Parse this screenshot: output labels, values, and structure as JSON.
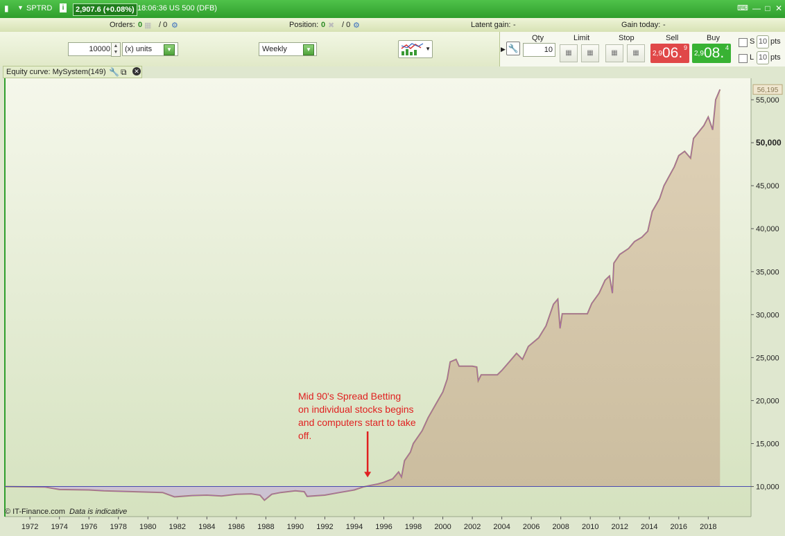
{
  "titlebar": {
    "symbol": "SPTRD",
    "price_change": "2,907.6 (+0.08%)",
    "time_market": "18:06:36 US 500 (DFB)"
  },
  "infobar": {
    "orders_label": "Orders:",
    "orders_value": "0",
    "orders_slash": "/ 0",
    "position_label": "Position:",
    "position_value": "0",
    "position_slash": "/ 0",
    "latent_label": "Latent gain:",
    "latent_value": "-",
    "gain_today_label": "Gain today:",
    "gain_today_value": "-"
  },
  "toolbar": {
    "quantity": "10000",
    "units": "(x) units",
    "timeframe": "Weekly"
  },
  "order_panel": {
    "qty_label": "Qty",
    "qty_value": "10",
    "limit_label": "Limit",
    "stop_label": "Stop",
    "sell_label": "Sell",
    "buy_label": "Buy",
    "sell_small": "2,9",
    "sell_big": "06.",
    "sell_sup": "9",
    "buy_small": "2,9",
    "buy_big": "08.",
    "buy_sup": "4",
    "s_label": "S",
    "l_label": "L",
    "s_pts_value": "10",
    "l_pts_value": "10",
    "pts_label": "pts"
  },
  "chart_panel": {
    "title": "Equity curve: MySystem(149)"
  },
  "footer": {
    "copyright": "© IT-Finance.com",
    "note": "Data is indicative"
  },
  "colors": {
    "title_green": "#38a834",
    "fill": "#d8cbb2",
    "line_main": "#a88a57",
    "line_spike": "#a25fd0",
    "baseline": "#4a4ab0",
    "below_fill": "#c8b3d8",
    "plot_bg_top": "#f4f6ea",
    "plot_bg_bottom": "#d7e4c1",
    "annotation": "#e02020"
  },
  "chart_data": {
    "type": "area",
    "title": "Equity curve: MySystem(149)",
    "xlabel": "",
    "ylabel": "",
    "xlim": [
      1970.3,
      2020.9
    ],
    "ylim": [
      6500,
      57500
    ],
    "baseline": 10000,
    "last_value_label": "56,195",
    "x_ticks": [
      1972,
      1974,
      1976,
      1978,
      1980,
      1982,
      1984,
      1986,
      1988,
      1990,
      1992,
      1994,
      1996,
      1998,
      2000,
      2002,
      2004,
      2006,
      2008,
      2010,
      2012,
      2014,
      2016,
      2018
    ],
    "y_ticks": [
      {
        "value": 10000,
        "label": "10,000",
        "bold": false
      },
      {
        "value": 15000,
        "label": "15,000",
        "bold": false
      },
      {
        "value": 20000,
        "label": "20,000",
        "bold": false
      },
      {
        "value": 25000,
        "label": "25,000",
        "bold": false
      },
      {
        "value": 30000,
        "label": "30,000",
        "bold": false
      },
      {
        "value": 35000,
        "label": "35,000",
        "bold": false
      },
      {
        "value": 40000,
        "label": "40,000",
        "bold": false
      },
      {
        "value": 45000,
        "label": "45,000",
        "bold": false
      },
      {
        "value": 50000,
        "label": "50,000",
        "bold": true
      },
      {
        "value": 55000,
        "label": "55,000",
        "bold": false
      }
    ],
    "series": [
      {
        "values": [
          [
            1970.3,
            10000
          ],
          [
            1973,
            9950
          ],
          [
            1974,
            9650
          ],
          [
            1976,
            9600
          ],
          [
            1977,
            9500
          ],
          [
            1979,
            9400
          ],
          [
            1981,
            9300
          ],
          [
            1981.8,
            8800
          ],
          [
            1983,
            8950
          ],
          [
            1984,
            9000
          ],
          [
            1985,
            8900
          ],
          [
            1986,
            9100
          ],
          [
            1987,
            9150
          ],
          [
            1987.6,
            9000
          ],
          [
            1987.9,
            8400
          ],
          [
            1988.4,
            9100
          ],
          [
            1989,
            9300
          ],
          [
            1990,
            9500
          ],
          [
            1990.6,
            9400
          ],
          [
            1990.8,
            8850
          ],
          [
            1992,
            9000
          ],
          [
            1993,
            9300
          ],
          [
            1994,
            9600
          ],
          [
            1994.6,
            9950
          ],
          [
            1995,
            10100
          ],
          [
            1995.6,
            10300
          ],
          [
            1996,
            10500
          ],
          [
            1996.6,
            10900
          ],
          [
            1997,
            11700
          ],
          [
            1997.2,
            11100
          ],
          [
            1997.4,
            13000
          ],
          [
            1997.8,
            14000
          ],
          [
            1998,
            15000
          ],
          [
            1998.6,
            16500
          ],
          [
            1999,
            18000
          ],
          [
            1999.5,
            19500
          ],
          [
            2000,
            21000
          ],
          [
            2000.3,
            22500
          ],
          [
            2000.5,
            24500
          ],
          [
            2000.9,
            24800
          ],
          [
            2001.1,
            24000
          ],
          [
            2002,
            24000
          ],
          [
            2002.3,
            23900
          ],
          [
            2002.4,
            22300
          ],
          [
            2002.6,
            23000
          ],
          [
            2003.7,
            23000
          ],
          [
            2004,
            23500
          ],
          [
            2004.5,
            24500
          ],
          [
            2005,
            25500
          ],
          [
            2005.4,
            24800
          ],
          [
            2005.8,
            26300
          ],
          [
            2006.5,
            27300
          ],
          [
            2007,
            28700
          ],
          [
            2007.5,
            31200
          ],
          [
            2007.8,
            31800
          ],
          [
            2007.95,
            28400
          ],
          [
            2008.1,
            30100
          ],
          [
            2009.8,
            30100
          ],
          [
            2010.1,
            31300
          ],
          [
            2010.6,
            32500
          ],
          [
            2011,
            34000
          ],
          [
            2011.3,
            34500
          ],
          [
            2011.5,
            32500
          ],
          [
            2011.6,
            36000
          ],
          [
            2012,
            37000
          ],
          [
            2012.6,
            37700
          ],
          [
            2013,
            38500
          ],
          [
            2013.5,
            39000
          ],
          [
            2013.9,
            39700
          ],
          [
            2014.2,
            42000
          ],
          [
            2014.7,
            43500
          ],
          [
            2015,
            45000
          ],
          [
            2015.7,
            47200
          ],
          [
            2016,
            48500
          ],
          [
            2016.4,
            49000
          ],
          [
            2016.8,
            48200
          ],
          [
            2017,
            50500
          ],
          [
            2017.7,
            52000
          ],
          [
            2018,
            53000
          ],
          [
            2018.3,
            51500
          ],
          [
            2018.5,
            55000
          ],
          [
            2018.8,
            56195
          ]
        ]
      }
    ],
    "annotations": [
      {
        "text": [
          "Mid 90's Spread Betting",
          "on individual stocks begins",
          "and computers start to take",
          "off."
        ],
        "arrow_to": [
          1994.9,
          10100
        ]
      }
    ]
  }
}
